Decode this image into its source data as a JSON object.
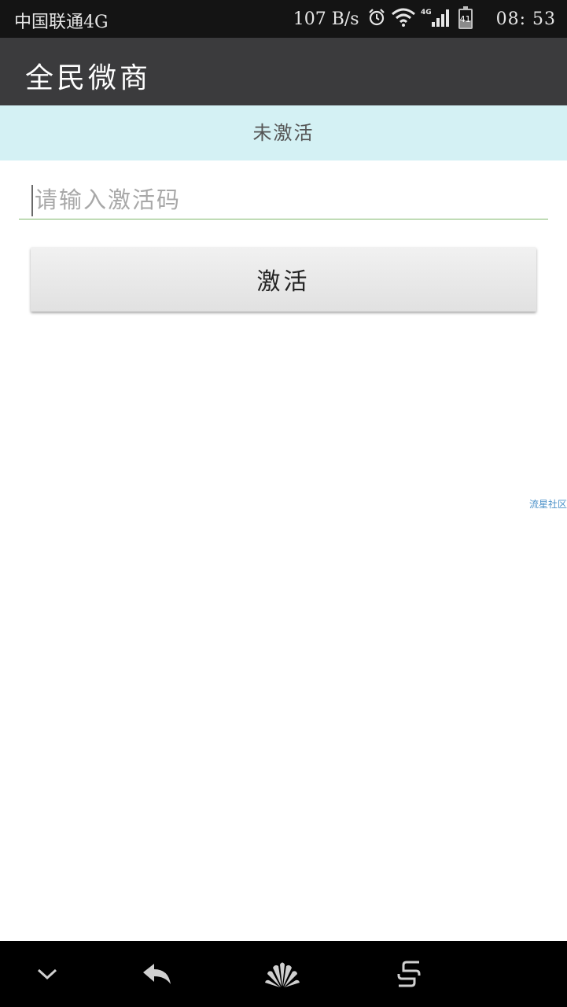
{
  "status_bar": {
    "carrier": "中国联通4G",
    "net_speed": "107 B/s",
    "battery_level": "41",
    "time": "08: 53",
    "icons": [
      "alarm-icon",
      "wifi-icon",
      "signal-4g-icon",
      "battery-icon"
    ]
  },
  "app_bar": {
    "title": "全民微商"
  },
  "activation": {
    "status": "未激活",
    "input_placeholder": "请输入激活码",
    "input_value": "",
    "button_label": "激活"
  },
  "watermark": "流星社区",
  "nav_bar": {
    "icons": [
      "chevron-down-icon",
      "back-icon",
      "huawei-logo-icon",
      "recent-apps-icon"
    ]
  },
  "colors": {
    "status_bar_bg": "#141414",
    "app_bar_bg": "#3b3b3d",
    "banner_bg": "#d4f1f4",
    "input_underline": "#7fb86a",
    "nav_bar_bg": "#000000"
  }
}
